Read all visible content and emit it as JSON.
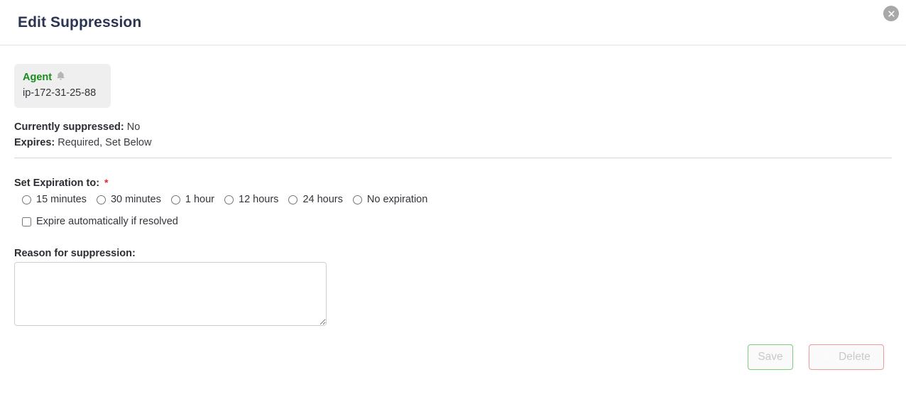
{
  "header": {
    "title": "Edit Suppression",
    "close_icon": "close-circle-icon"
  },
  "agent": {
    "label": "Agent",
    "bell_icon": "bell-icon",
    "hostname": "ip-172-31-25-88"
  },
  "status": {
    "suppressed_key": "Currently suppressed:",
    "suppressed_value": "No",
    "expires_key": "Expires:",
    "expires_value": "Required, Set Below"
  },
  "expiration": {
    "label": "Set Expiration to:",
    "required_marker": "*",
    "options": [
      {
        "label": "15 minutes",
        "checked": false
      },
      {
        "label": "30 minutes",
        "checked": false
      },
      {
        "label": "1 hour",
        "checked": false
      },
      {
        "label": "12 hours",
        "checked": false
      },
      {
        "label": "24 hours",
        "checked": false
      },
      {
        "label": "No expiration",
        "checked": false
      }
    ],
    "auto_expire": {
      "label": "Expire automatically if resolved",
      "checked": false
    }
  },
  "reason": {
    "label": "Reason for suppression:",
    "value": "",
    "placeholder": ""
  },
  "footer": {
    "save_label": "Save",
    "delete_label": "Delete",
    "delete_icon": "trash-icon",
    "save_disabled": true,
    "delete_disabled": true
  },
  "colors": {
    "title": "#2b3553",
    "agent_green": "#1a8a1a",
    "required_red": "#e8242a",
    "save_border": "#7ad17a",
    "delete_border": "#f09a98",
    "disabled_text": "#c9c9c9",
    "divider": "#d6d6d6",
    "chip_bg": "#efefef"
  }
}
